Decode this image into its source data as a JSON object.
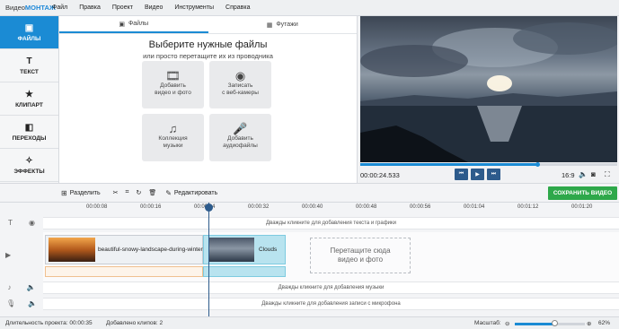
{
  "app": {
    "brand_plain": "Видео",
    "brand_accent": "МОНТАЖ"
  },
  "menu": [
    "Файл",
    "Правка",
    "Проект",
    "Видео",
    "Инструменты",
    "Справка"
  ],
  "sidebar": [
    {
      "label": "ФАЙЛЫ",
      "icon": "film-icon",
      "active": true
    },
    {
      "label": "ТЕКСТ",
      "icon": "text-icon"
    },
    {
      "label": "КЛИПАРТ",
      "icon": "star-icon"
    },
    {
      "label": "ПЕРЕХОДЫ",
      "icon": "transitions-icon"
    },
    {
      "label": "ЭФФЕКТЫ",
      "icon": "wand-icon"
    }
  ],
  "filepanel": {
    "tabs": [
      "Файлы",
      "Футажи"
    ],
    "title": "Выберите нужные файлы",
    "subtitle": "или просто перетащите их из проводника",
    "tiles": [
      {
        "line1": "Добавить",
        "line2": "видео и фото",
        "icon": "film-reel-icon"
      },
      {
        "line1": "Записать",
        "line2": "с веб-камеры",
        "icon": "webcam-icon"
      },
      {
        "line1": "Коллекция",
        "line2": "музыки",
        "icon": "music-note-icon"
      },
      {
        "line1": "Добавить",
        "line2": "аудиофайлы",
        "icon": "microphone-icon"
      }
    ]
  },
  "preview": {
    "timecode": "00:00:24.533",
    "progress": 0.69,
    "aspect": "16:9"
  },
  "toolbar": {
    "split": "Разделить",
    "edit": "Редактировать",
    "save": "СОХРАНИТЬ ВИДЕО"
  },
  "ruler": [
    "00:00:08",
    "00:00:16",
    "00:00:24",
    "00:00:32",
    "00:00:40",
    "00:00:48",
    "00:00:56",
    "00:01:04",
    "00:01:12",
    "00:01:20"
  ],
  "timeline": {
    "text_lane": "Дважды кликните для добавления текста и графики",
    "clip1": "beautiful-snowy-landscape-during-winter",
    "clip2": "Clouds",
    "drop_line1": "Перетащите сюда",
    "drop_line2": "видео и фото",
    "music_lane": "Дважды кликните для добавления музыки",
    "mic_lane": "Дважды кликните для добавления записи с микрофона"
  },
  "status": {
    "duration": "Длительность проекта: 00:00:35",
    "clips": "Добавлено клипов: 2",
    "zoom_label": "Масштаб:",
    "zoom_value": "62%",
    "zoom_level": 0.56
  },
  "colors": {
    "accent": "#1b8bd4",
    "save": "#2ea84a",
    "playhead": "#2d5b8c"
  }
}
